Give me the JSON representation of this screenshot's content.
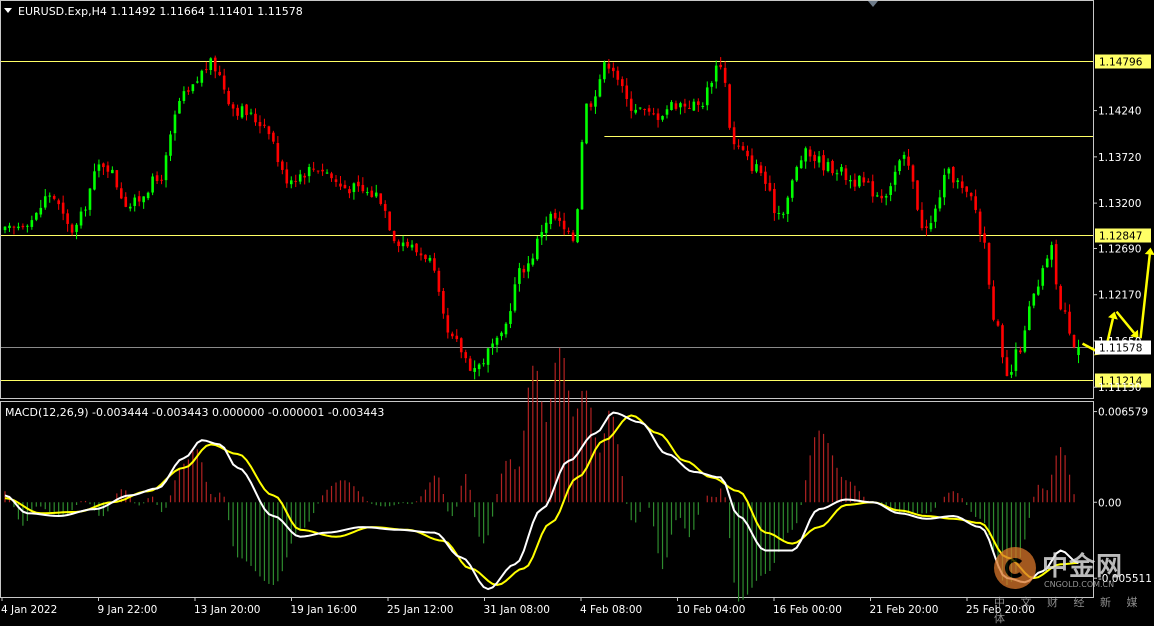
{
  "header": {
    "symbol_line": "EURUSD.Exp,H4  1.11492 1.11664 1.11401 1.11578"
  },
  "macd": {
    "label": "MACD(12,26,9) -0.003444 -0.003443 0.000000 -0.000001 -0.003443"
  },
  "watermark": {
    "brand": "中金网",
    "url": "CNGOLD.COM.CN",
    "tagline": "中 文 财 经 新 媒 体"
  },
  "colors": {
    "background": "#000000",
    "bull": "#00ff00",
    "bear": "#ff0000",
    "level_line": "#ffff66",
    "arrow": "#ffff00",
    "macd_line": "#ffffff",
    "signal_line": "#ffff00",
    "hist_pos": "#b22222",
    "hist_neg": "#2e8b2e"
  },
  "chart_data": [
    {
      "type": "candlestick",
      "symbol": "EURUSD.Exp",
      "timeframe": "H4",
      "ohlc_last": {
        "open": 1.11492,
        "high": 1.11664,
        "low": 1.11401,
        "close": 1.11578
      },
      "ylim": [
        1.1102,
        1.1545
      ],
      "y_ticks": [
        "1.14240",
        "1.13720",
        "1.13200",
        "1.12690",
        "1.12170",
        "1.11650",
        "1.11130"
      ],
      "x_ticks": [
        "4 Jan 2022",
        "9 Jan 22:00",
        "13 Jan 20:00",
        "19 Jan 16:00",
        "25 Jan 12:00",
        "31 Jan 08:00",
        "4 Feb 08:00",
        "10 Feb 04:00",
        "16 Feb 00:00",
        "21 Feb 20:00",
        "25 Feb 20:00"
      ],
      "levels": [
        {
          "value": 1.14796,
          "label": "1.14796",
          "kind": "resistance",
          "span": "full"
        },
        {
          "value": 1.1396,
          "label": "",
          "kind": "resistance",
          "span": "from 4 Feb"
        },
        {
          "value": 1.12847,
          "label": "1.12847",
          "kind": "pivot",
          "span": "full"
        },
        {
          "value": 1.11214,
          "label": "1.11214",
          "kind": "support",
          "span": "full"
        }
      ],
      "current_price": {
        "value": 1.11578,
        "label": "1.11578"
      },
      "anchors": [
        {
          "t": 0,
          "p": 1.1288
        },
        {
          "t": 6,
          "p": 1.1302
        },
        {
          "t": 10,
          "p": 1.133
        },
        {
          "t": 15,
          "p": 1.129
        },
        {
          "t": 22,
          "p": 1.1365
        },
        {
          "t": 28,
          "p": 1.1318
        },
        {
          "t": 34,
          "p": 1.1345
        },
        {
          "t": 40,
          "p": 1.144
        },
        {
          "t": 46,
          "p": 1.1476
        },
        {
          "t": 52,
          "p": 1.1425
        },
        {
          "t": 58,
          "p": 1.141
        },
        {
          "t": 63,
          "p": 1.1348
        },
        {
          "t": 70,
          "p": 1.136
        },
        {
          "t": 76,
          "p": 1.1338
        },
        {
          "t": 83,
          "p": 1.133
        },
        {
          "t": 88,
          "p": 1.1278
        },
        {
          "t": 94,
          "p": 1.1262
        },
        {
          "t": 100,
          "p": 1.1165
        },
        {
          "t": 105,
          "p": 1.1135
        },
        {
          "t": 110,
          "p": 1.1162
        },
        {
          "t": 116,
          "p": 1.1248
        },
        {
          "t": 122,
          "p": 1.1305
        },
        {
          "t": 127,
          "p": 1.128
        },
        {
          "t": 130,
          "p": 1.143
        },
        {
          "t": 135,
          "p": 1.1478
        },
        {
          "t": 140,
          "p": 1.143
        },
        {
          "t": 145,
          "p": 1.1418
        },
        {
          "t": 150,
          "p": 1.1432
        },
        {
          "t": 155,
          "p": 1.143
        },
        {
          "t": 160,
          "p": 1.1478
        },
        {
          "t": 163,
          "p": 1.1385
        },
        {
          "t": 168,
          "p": 1.136
        },
        {
          "t": 173,
          "p": 1.131
        },
        {
          "t": 179,
          "p": 1.1375
        },
        {
          "t": 185,
          "p": 1.136
        },
        {
          "t": 190,
          "p": 1.1345
        },
        {
          "t": 196,
          "p": 1.133
        },
        {
          "t": 201,
          "p": 1.1368
        },
        {
          "t": 206,
          "p": 1.129
        },
        {
          "t": 211,
          "p": 1.1352
        },
        {
          "t": 216,
          "p": 1.1325
        },
        {
          "t": 219,
          "p": 1.1275
        },
        {
          "t": 221,
          "p": 1.1195
        },
        {
          "t": 224,
          "p": 1.1122
        },
        {
          "t": 227,
          "p": 1.1158
        },
        {
          "t": 230,
          "p": 1.1215
        },
        {
          "t": 234,
          "p": 1.1268
        },
        {
          "t": 236,
          "p": 1.12
        },
        {
          "t": 240,
          "p": 1.1158
        }
      ],
      "projection_arrows": [
        {
          "from": 1.1162,
          "to": 1.115
        },
        {
          "from": 1.115,
          "to": 1.1198
        },
        {
          "from": 1.1198,
          "to": 1.1168
        },
        {
          "from": 1.1168,
          "to": 1.127
        }
      ]
    },
    {
      "type": "macd",
      "params": "12,26,9",
      "ylim": [
        -0.0068,
        0.0072
      ],
      "y_ticks": [
        "0.006579",
        "0.00",
        "-0.005511"
      ],
      "macd": [
        [
          0,
          0.0005
        ],
        [
          5,
          -0.0008
        ],
        [
          12,
          -0.001
        ],
        [
          20,
          -0.0005
        ],
        [
          28,
          0.0005
        ],
        [
          34,
          0.001
        ],
        [
          40,
          0.0032
        ],
        [
          44,
          0.0045
        ],
        [
          48,
          0.0042
        ],
        [
          52,
          0.0025
        ],
        [
          60,
          -0.001
        ],
        [
          66,
          -0.0025
        ],
        [
          72,
          -0.0022
        ],
        [
          80,
          -0.0018
        ],
        [
          88,
          -0.002
        ],
        [
          96,
          -0.0022
        ],
        [
          102,
          -0.004
        ],
        [
          108,
          -0.0063
        ],
        [
          114,
          -0.0045
        ],
        [
          120,
          -0.0005
        ],
        [
          126,
          0.003
        ],
        [
          132,
          0.005
        ],
        [
          136,
          0.0065
        ],
        [
          142,
          0.0058
        ],
        [
          148,
          0.0035
        ],
        [
          154,
          0.0022
        ],
        [
          160,
          0.0018
        ],
        [
          164,
          -0.001
        ],
        [
          170,
          -0.0035
        ],
        [
          176,
          -0.0035
        ],
        [
          182,
          -0.0005
        ],
        [
          188,
          0.0002
        ],
        [
          194,
          0.0
        ],
        [
          200,
          -0.0008
        ],
        [
          206,
          -0.0012
        ],
        [
          212,
          -0.001
        ],
        [
          218,
          -0.0018
        ],
        [
          224,
          -0.0055
        ],
        [
          228,
          -0.0058
        ],
        [
          232,
          -0.005
        ],
        [
          236,
          -0.0035
        ],
        [
          240,
          -0.0044
        ]
      ],
      "signal": [
        [
          0,
          0.0003
        ],
        [
          8,
          -0.0008
        ],
        [
          16,
          -0.0007
        ],
        [
          24,
          0.0
        ],
        [
          32,
          0.0008
        ],
        [
          40,
          0.0025
        ],
        [
          46,
          0.0042
        ],
        [
          52,
          0.0035
        ],
        [
          60,
          0.0005
        ],
        [
          66,
          -0.002
        ],
        [
          74,
          -0.0025
        ],
        [
          82,
          -0.0018
        ],
        [
          90,
          -0.002
        ],
        [
          98,
          -0.0028
        ],
        [
          104,
          -0.0048
        ],
        [
          110,
          -0.006
        ],
        [
          116,
          -0.0048
        ],
        [
          122,
          -0.0015
        ],
        [
          128,
          0.0018
        ],
        [
          134,
          0.0045
        ],
        [
          140,
          0.0063
        ],
        [
          146,
          0.005
        ],
        [
          152,
          0.003
        ],
        [
          158,
          0.0018
        ],
        [
          164,
          0.0008
        ],
        [
          170,
          -0.0022
        ],
        [
          176,
          -0.003
        ],
        [
          182,
          -0.0018
        ],
        [
          188,
          -0.0002
        ],
        [
          194,
          0.0
        ],
        [
          200,
          -0.0006
        ],
        [
          206,
          -0.001
        ],
        [
          212,
          -0.0012
        ],
        [
          218,
          -0.0015
        ],
        [
          224,
          -0.004
        ],
        [
          230,
          -0.0055
        ],
        [
          236,
          -0.0045
        ],
        [
          240,
          -0.0044
        ]
      ]
    }
  ]
}
